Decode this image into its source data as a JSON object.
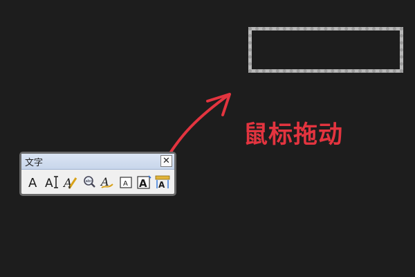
{
  "palette": {
    "title": "文字",
    "close_label": "✕",
    "tools": [
      {
        "name": "single-line-text-icon",
        "glyph": "A"
      },
      {
        "name": "multiline-text-icon",
        "glyph": "AI"
      },
      {
        "name": "edit-text-icon",
        "glyph": "A"
      },
      {
        "name": "find-replace-icon",
        "glyph": "abc"
      },
      {
        "name": "spell-check-icon",
        "glyph": "A"
      },
      {
        "name": "text-style-icon",
        "glyph": "A"
      },
      {
        "name": "scale-text-icon",
        "glyph": "A"
      },
      {
        "name": "justify-text-icon",
        "glyph": "A"
      }
    ]
  },
  "annotation": {
    "text": "鼠标拖动",
    "color": "#e3343f"
  },
  "colors": {
    "background": "#1d1d1d",
    "selection_border": "#b9b9b9",
    "arrow": "#e3343f"
  }
}
